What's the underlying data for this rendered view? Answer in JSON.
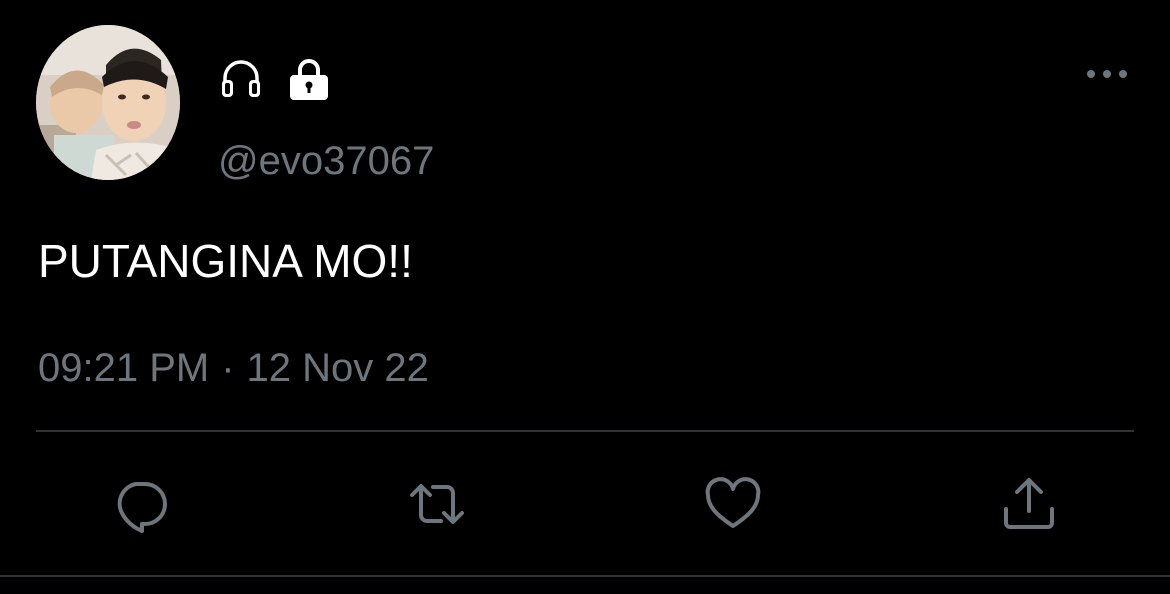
{
  "tweet": {
    "handle": "@evo37067",
    "text": "PUTANGINA MO!!",
    "time": "09:21 PM",
    "separator": "·",
    "date": "12 Nov 22",
    "name_icons": [
      "headphones-icon",
      "lock-icon"
    ],
    "actions": [
      "reply-icon",
      "retweet-icon",
      "like-icon",
      "share-icon"
    ],
    "more_icon": "more-options-icon"
  },
  "colors": {
    "background": "#000000",
    "text": "#ffffff",
    "secondary_text": "#6e767d",
    "icon": "#6e767d",
    "divider": "#2f3336"
  }
}
